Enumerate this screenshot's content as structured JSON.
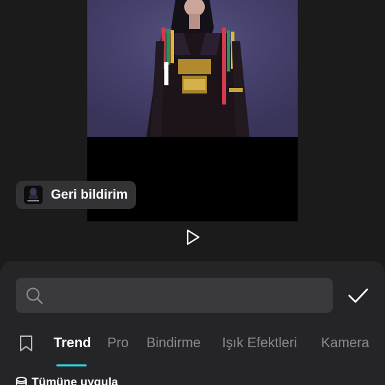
{
  "feedback": {
    "label": "Geri bildirim",
    "thumbnail_icon": "video-thumbnail"
  },
  "player": {
    "play_icon": "play-icon"
  },
  "search": {
    "value": "",
    "placeholder": ""
  },
  "tabs": [
    {
      "label": "Trend",
      "active": true
    },
    {
      "label": "Pro",
      "active": false
    },
    {
      "label": "Bindirme",
      "active": false
    },
    {
      "label": "Işık Efektleri",
      "active": false
    },
    {
      "label": "Kamera",
      "active": false
    }
  ],
  "apply_all": {
    "label": "Tümüne uygula",
    "icon": "layers-icon"
  },
  "colors": {
    "accent": "#2fd6e0",
    "background": "#1b1b1b",
    "panel": "#252527",
    "input": "#3a3a3c"
  }
}
